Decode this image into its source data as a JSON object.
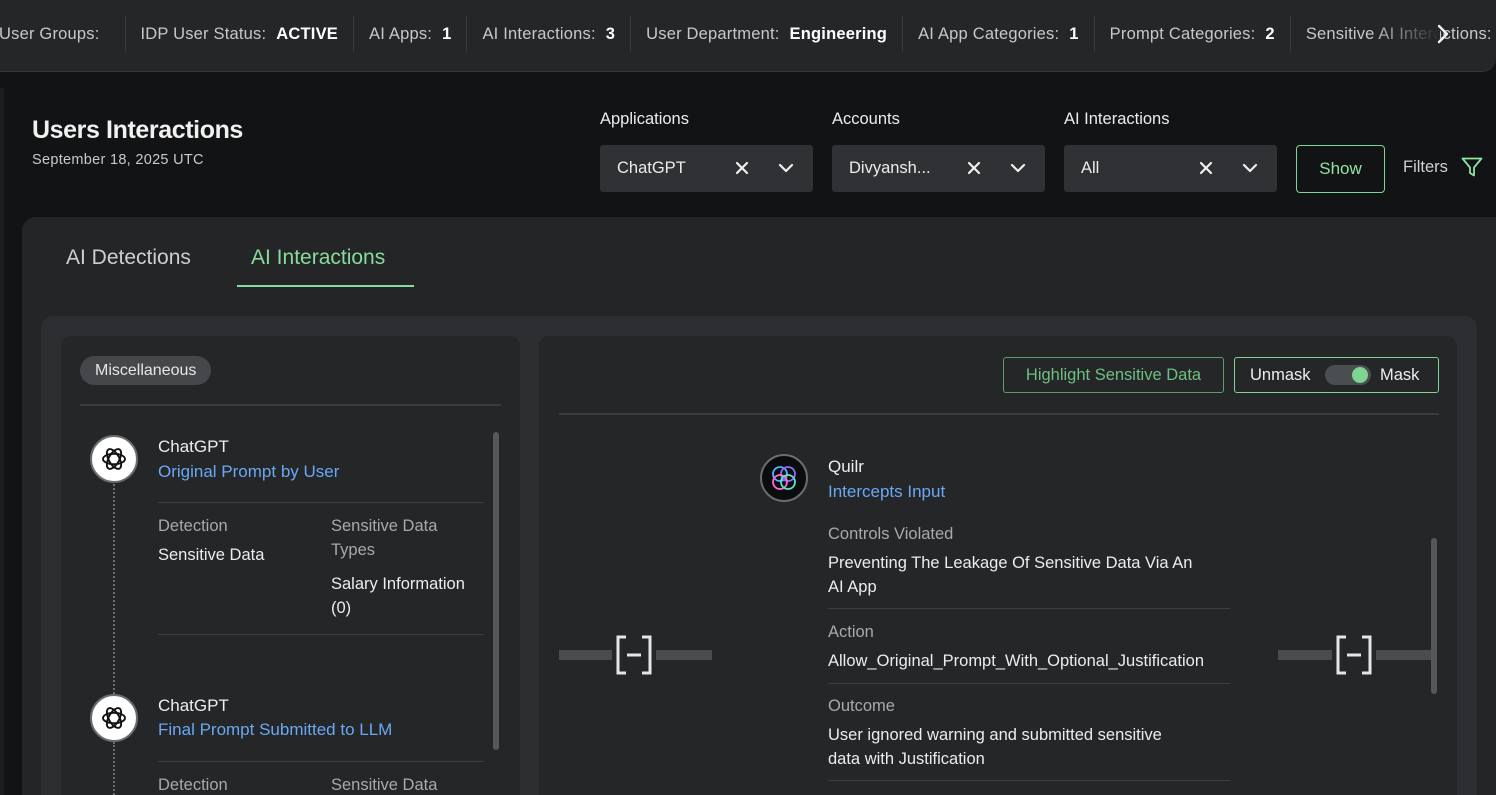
{
  "stats_bar": {
    "items": [
      {
        "key": "User Groups:",
        "value": ""
      },
      {
        "key": "IDP User Status:",
        "value": "ACTIVE"
      },
      {
        "key": "AI Apps:",
        "value": "1"
      },
      {
        "key": "AI Interactions:",
        "value": "3"
      },
      {
        "key": "User Department:",
        "value": "Engineering"
      },
      {
        "key": "AI App Categories:",
        "value": "1"
      },
      {
        "key": "Prompt Categories:",
        "value": "2"
      },
      {
        "key": "Sensitive AI Interactions:",
        "value": ""
      }
    ],
    "next_icon": "chevron-right-icon"
  },
  "header": {
    "title": "Users Interactions",
    "date": "September 18, 2025 UTC"
  },
  "filters": {
    "applications": {
      "label": "Applications",
      "value": "ChatGPT"
    },
    "accounts": {
      "label": "Accounts",
      "value": "Divyansh..."
    },
    "ai_interactions": {
      "label": "AI Interactions",
      "value": "All"
    },
    "show_label": "Show",
    "filters_label": "Filters",
    "filter_icon": "funnel-icon"
  },
  "tabs": {
    "detections": "AI Detections",
    "interactions": "AI Interactions",
    "active": "interactions"
  },
  "left_card": {
    "chip": "Miscellaneous",
    "entries": [
      {
        "app": "ChatGPT",
        "subtitle": "Original Prompt by User",
        "detection_label": "Detection",
        "detection_value": "Sensitive Data",
        "types_label_line1": "Sensitive Data",
        "types_label_line2": "Types",
        "types_value_line1": "Salary Information",
        "types_value_line2": "(0)"
      },
      {
        "app": "ChatGPT",
        "subtitle": "Final Prompt Submitted to LLM",
        "detection_label": "Detection",
        "types_label_line1": "Sensitive Data"
      }
    ]
  },
  "right_card": {
    "highlight_label": "Highlight Sensitive Data",
    "unmask_label": "Unmask",
    "mask_label": "Mask",
    "mask_on": true,
    "quilr": {
      "name": "Quilr",
      "subtitle": "Intercepts Input",
      "controls_label": "Controls Violated",
      "controls_line1": "Preventing The Leakage Of Sensitive Data Via An",
      "controls_line2": "AI App",
      "action_label": "Action",
      "action_value": "Allow_Original_Prompt_With_Optional_Justification",
      "outcome_label": "Outcome",
      "outcome_line1": "User ignored warning and submitted sensitive",
      "outcome_line2": "data with Justification"
    }
  },
  "colors": {
    "accent_green": "#87dc9b",
    "link_blue": "#6aa8f4",
    "background": "#121314"
  }
}
